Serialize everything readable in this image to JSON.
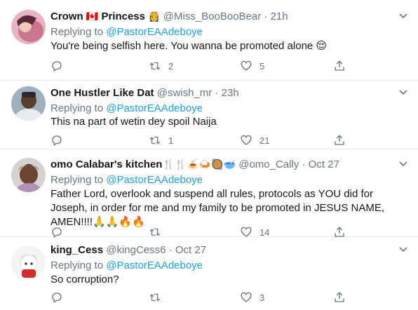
{
  "colors": {
    "link": "#1da1f2",
    "secondary": "#657786",
    "text": "#14171a",
    "divider": "#e6ecf0"
  },
  "tweets": [
    {
      "name": "Crown",
      "name_emojis_mid": "🇨🇦",
      "name_after": "Princess",
      "name_emojis_end": "👸",
      "handle": "@Miss_BooBooBear",
      "dot": "·",
      "time": "21h",
      "replying_prefix": "Replying to",
      "replying_to": "@PastorEAAdeboye",
      "text": "You're being selfish here. You wanna be promoted alone 😌",
      "reply_count": "",
      "retweet_count": "2",
      "like_count": "5"
    },
    {
      "name": "One Hustler Like Dat",
      "handle": "@swish_mr",
      "dot": "·",
      "time": "23h",
      "replying_prefix": "Replying to",
      "replying_to": "@PastorEAAdeboye",
      "text": "This na part of wetin dey spoil Naija",
      "reply_count": "",
      "retweet_count": "1",
      "like_count": "21"
    },
    {
      "name": "omo Calabar's kitchen",
      "name_emojis_end": "🍴🍴🍝🍛🥘🥣",
      "handle": "@omo_Cally",
      "dot": "·",
      "time": "Oct 27",
      "replying_prefix": "Replying to",
      "replying_to": "@PastorEAAdeboye",
      "text": "Father Lord, overlook and suspend all rules, protocols as YOU did for Joseph, in order for me and my family to be promoted in JESUS NAME, AMEN!!!!🙏🙏🔥🔥",
      "reply_count": "",
      "retweet_count": "",
      "like_count": "14"
    },
    {
      "name": "king_Cess",
      "handle": "@kingCess6",
      "dot": "·",
      "time": "Oct 27",
      "replying_prefix": "Replying to",
      "replying_to": "@PastorEAAdeboye",
      "text": "So corruption?",
      "reply_count": "",
      "retweet_count": "",
      "like_count": "3"
    }
  ]
}
